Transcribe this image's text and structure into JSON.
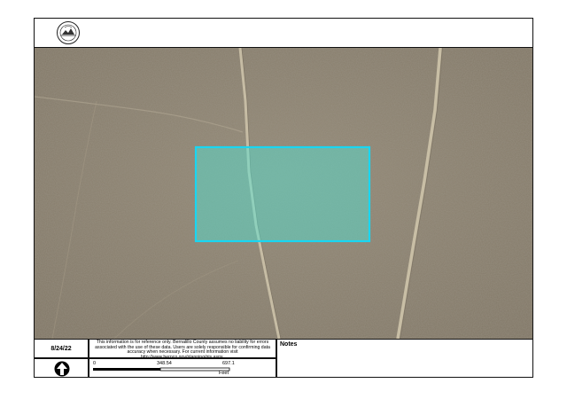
{
  "seal": {
    "top_text": "BERNALILLO COUNTY",
    "bottom_text": "STATE OF NEW MEXICO",
    "icon": "county-seal-icon"
  },
  "map": {
    "parcel_outline_color": "#19d6f2",
    "parcel_fill_color": "#4ee6d8"
  },
  "footer": {
    "date": "8/24/22",
    "disclaimer": "This information is for reference only. Bernalillo County assumes no liability for errors associated with the use of these data. Users are solely responsible for confirming data accuracy when necessary. For current information visit http://www.bernco.gov/planning/gis.aspx.",
    "north_arrow_icon": "north-arrow-icon",
    "scale": {
      "labels": [
        "0",
        "348.54",
        "697.1"
      ],
      "unit": "Feet"
    },
    "notes_title": "Notes"
  }
}
